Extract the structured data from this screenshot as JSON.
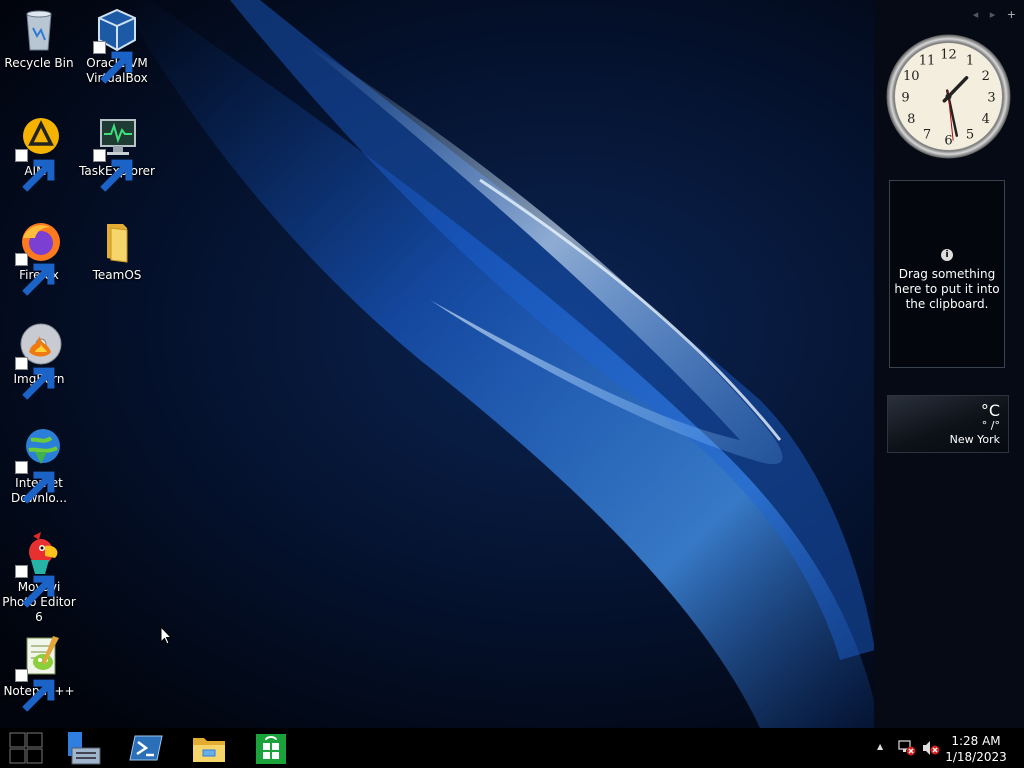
{
  "desktop": {
    "icons": [
      {
        "label": "Recycle Bin",
        "icon": "recycle-bin-icon"
      },
      {
        "label": "Oracle VM VirtualBox",
        "icon": "virtualbox-icon"
      },
      {
        "label": "AIMP",
        "icon": "aimp-icon"
      },
      {
        "label": "TaskExplorer",
        "icon": "task-explorer-icon"
      },
      {
        "label": "Firefox",
        "icon": "firefox-icon"
      },
      {
        "label": "TeamOS",
        "icon": "folder-icon"
      },
      {
        "label": "ImgBurn",
        "icon": "imgburn-icon"
      },
      {
        "label": "Internet Downlo...",
        "icon": "internet-download-manager-icon"
      },
      {
        "label": "Movavi Photo Editor 6",
        "icon": "movavi-photo-editor-icon"
      },
      {
        "label": "Notepad++",
        "icon": "notepad-plus-plus-icon"
      }
    ]
  },
  "sidebar": {
    "nav_prev": "◂",
    "nav_next": "▸",
    "add": "+",
    "clock": {
      "hour": 1,
      "minute": 28,
      "second": 29
    },
    "clipboard": {
      "info_glyph": "i",
      "message": "Drag something here to put it into the clipboard."
    },
    "weather": {
      "temp": "°C",
      "range": "° /°",
      "city": "New York"
    }
  },
  "taskbar": {
    "buttons": [
      {
        "name": "start-button",
        "icon": "start-icon"
      },
      {
        "name": "server-manager-button",
        "icon": "server-manager-icon"
      },
      {
        "name": "powershell-button",
        "icon": "powershell-icon"
      },
      {
        "name": "file-explorer-button",
        "icon": "file-explorer-icon"
      },
      {
        "name": "store-button",
        "icon": "store-icon"
      }
    ],
    "tray": {
      "show_hidden": "▲",
      "time": "1:28 AM",
      "date": "1/18/2023"
    }
  },
  "colors": {
    "accent_blue": "#2f7fe0",
    "store_green": "#1aa33a",
    "folder_yellow": "#f3c74a"
  }
}
